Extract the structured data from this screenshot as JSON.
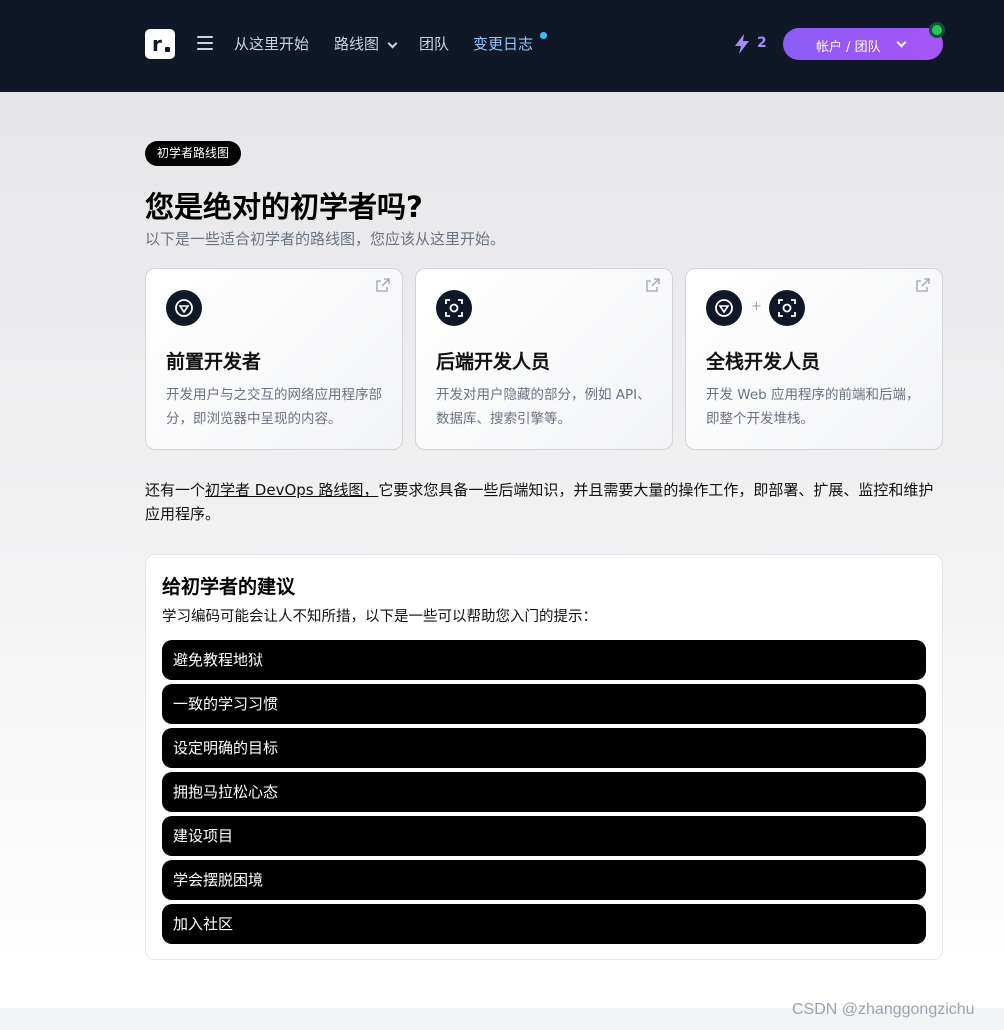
{
  "nav": {
    "logo_letter": "r",
    "links": [
      "从这里开始",
      "路线图",
      "团队",
      "变更日志"
    ],
    "streak_count": "2",
    "account_label": "帐户 / 团队",
    "icons": {
      "menu": "hamburger-icon",
      "streak": "lightning-icon",
      "online": "status-dot"
    }
  },
  "hero": {
    "badge": "初学者路线图",
    "title": "您是绝对的初学者吗?",
    "subtitle": "以下是一些适合初学者的路线图，您应该从这里开始。"
  },
  "cards": [
    {
      "title": "前置开发者",
      "desc": "开发用户与之交互的网络应用程序部分，即浏览器中呈现的内容。",
      "icons": [
        "frontend-icon"
      ]
    },
    {
      "title": "后端开发人员",
      "desc": "开发对用户隐藏的部分，例如 API、数据库、搜索引擎等。",
      "icons": [
        "backend-icon"
      ]
    },
    {
      "title": "全栈开发人员",
      "desc": "开发 Web 应用程序的前端和后端，即整个开发堆栈。",
      "icons": [
        "frontend-icon",
        "backend-icon"
      ],
      "plus": "+"
    }
  ],
  "devops": {
    "before": "还有一个",
    "link": "初学者 DevOps 路线图，",
    "after": "它要求您具备一些后端知识，并且需要大量的操作工作，即部署、扩展、监控和维护应用程序。"
  },
  "tips": {
    "title": "给初学者的建议",
    "subtitle": "学习编码可能会让人不知所措，以下是一些可以帮助您入门的提示：",
    "items": [
      "避免教程地狱",
      "一致的学习习惯",
      "设定明确的目标",
      "拥抱马拉松心态",
      "建设项目",
      "学会摆脱困境",
      "加入社区"
    ]
  },
  "watermark": "CSDN @zhanggongzichu",
  "colors": {
    "nav_bg": "#101828",
    "accent_purple": "#8b5cf6",
    "changelog_blue": "#93c5fd",
    "online_green": "#22c55e"
  }
}
